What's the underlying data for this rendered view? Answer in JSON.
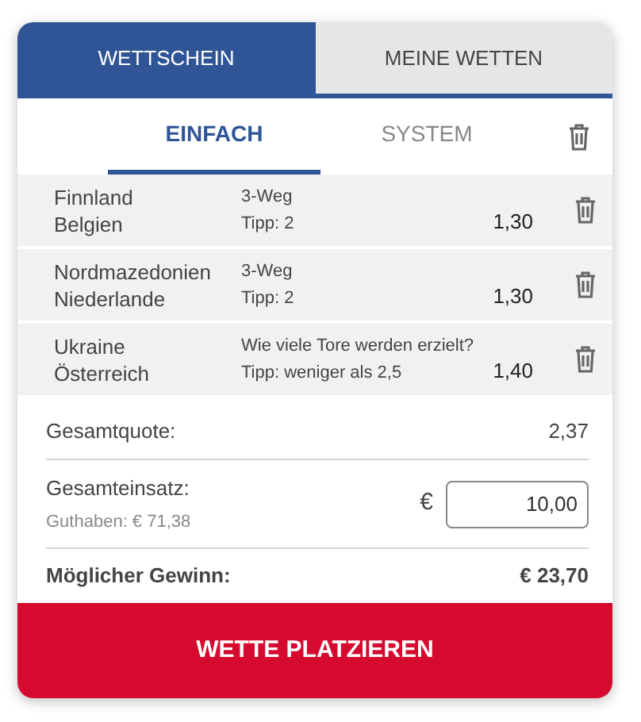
{
  "tabs": [
    {
      "label": "WETTSCHEIN",
      "selected": true
    },
    {
      "label": "MEINE WETTEN",
      "selected": false
    }
  ],
  "bet_types": [
    {
      "label": "EINFACH",
      "selected": true
    },
    {
      "label": "SYSTEM",
      "selected": false
    }
  ],
  "bets": [
    {
      "home": "Finnland",
      "away": "Belgien",
      "market": "3-Weg",
      "tip": "Tipp: 2",
      "odds": "1,30"
    },
    {
      "home": "Nordmazedonien",
      "away": "Niederlande",
      "market": "3-Weg",
      "tip": "Tipp: 2",
      "odds": "1,30"
    },
    {
      "home": "Ukraine",
      "away": "Österreich",
      "market": "Wie viele Tore werden erzielt?",
      "tip": "Tipp: weniger als 2,5",
      "odds": "1,40"
    }
  ],
  "total_odds": {
    "label": "Gesamtquote:",
    "value": "2,37"
  },
  "stake": {
    "label": "Gesamteinsatz:",
    "balance": "Guthaben: € 71,38",
    "currency": "€",
    "value": "10,00"
  },
  "win": {
    "label": "Möglicher Gewinn:",
    "value": "€ 23,70"
  },
  "submit": "WETTE PLATZIEREN"
}
